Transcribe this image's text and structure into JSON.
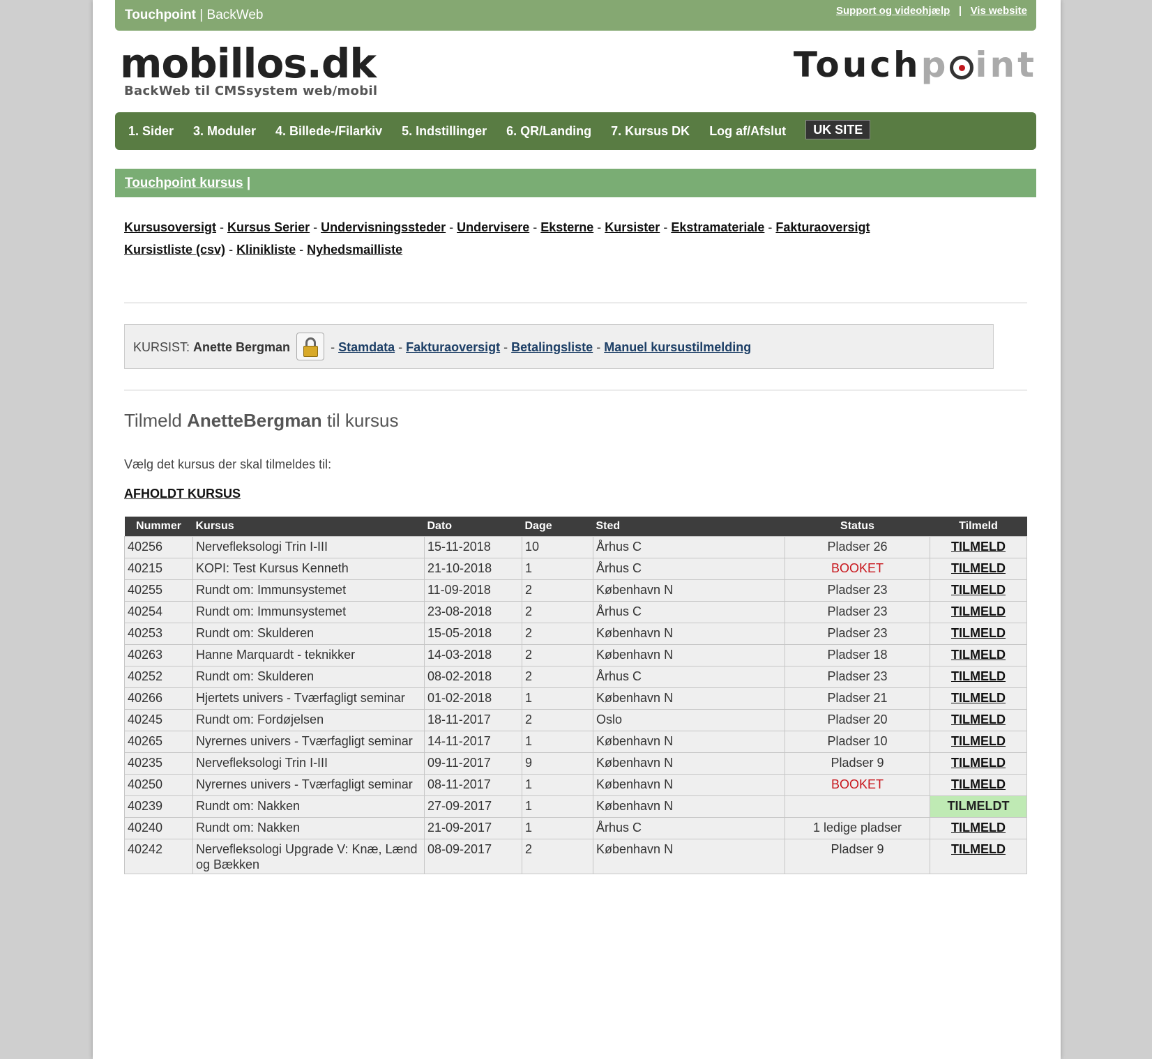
{
  "topbar": {
    "brand_bold": "Touchpoint",
    "brand_sep": " | ",
    "brand_rest": "BackWeb",
    "support_link": "Support og videohjælp",
    "sep": " | ",
    "website_link": "Vis website"
  },
  "logo_left": {
    "title": "mobillos.dk",
    "subtitle": "BackWeb til CMSsystem web/mobil"
  },
  "logo_right": {
    "part1": "Touch",
    "part2": "p",
    "part3": "int"
  },
  "mainnav": [
    "1. Sider",
    "3. Moduler",
    "4. Billede-/Filarkiv",
    "5. Indstillinger",
    "6. QR/Landing",
    "7. Kursus DK",
    "Log af/Afslut",
    "UK SITE"
  ],
  "subbar": {
    "link": "Touchpoint kursus",
    "sep": " |"
  },
  "submenu": {
    "row1": [
      "Kursusoversigt",
      "Kursus Serier",
      "Undervisningssteder",
      "Undervisere",
      "Eksterne",
      "Kursister",
      "Ekstramateriale",
      "Fakturaoversigt"
    ],
    "row2": [
      "Kursistliste (csv)",
      "Klinikliste",
      "Nyhedsmailliste"
    ],
    "sep": " - "
  },
  "kursist": {
    "label": "KURSIST: ",
    "name": "Anette Bergman",
    "dash": " - ",
    "links": [
      "Stamdata",
      "Fakturaoversigt",
      "Betalingsliste",
      "Manuel kursustilmelding"
    ]
  },
  "heading": {
    "pre": "Tilmeld ",
    "name": "AnetteBergman",
    "post": " til kursus"
  },
  "intro": "Vælg det kursus der skal tilmeldes til:",
  "afholdt": "AFHOLDT KURSUS",
  "table": {
    "headers": [
      "Nummer",
      "Kursus",
      "Dato",
      "Dage",
      "Sted",
      "Status",
      "Tilmeld"
    ],
    "rows": [
      [
        "40256",
        "Nervefleksologi Trin I-III",
        "15-11-2018",
        "10",
        "Århus C",
        "Pladser 26",
        "TILMELD"
      ],
      [
        "40215",
        "KOPI: Test Kursus Kenneth",
        "21-10-2018",
        "1",
        "Århus C",
        "BOOKET",
        "TILMELD"
      ],
      [
        "40255",
        "Rundt om: Immunsystemet",
        "11-09-2018",
        "2",
        "København N",
        "Pladser 23",
        "TILMELD"
      ],
      [
        "40254",
        "Rundt om: Immunsystemet",
        "23-08-2018",
        "2",
        "Århus C",
        "Pladser 23",
        "TILMELD"
      ],
      [
        "40253",
        "Rundt om: Skulderen",
        "15-05-2018",
        "2",
        "København N",
        "Pladser 23",
        "TILMELD"
      ],
      [
        "40263",
        "Hanne Marquardt - teknikker",
        "14-03-2018",
        "2",
        "København N",
        "Pladser 18",
        "TILMELD"
      ],
      [
        "40252",
        "Rundt om: Skulderen",
        "08-02-2018",
        "2",
        "Århus C",
        "Pladser 23",
        "TILMELD"
      ],
      [
        "40266",
        "Hjertets univers - Tværfagligt seminar",
        "01-02-2018",
        "1",
        "København N",
        "Pladser 21",
        "TILMELD"
      ],
      [
        "40245",
        "Rundt om: Fordøjelsen",
        "18-11-2017",
        "2",
        "Oslo",
        "Pladser 20",
        "TILMELD"
      ],
      [
        "40265",
        "Nyrernes univers - Tværfagligt seminar",
        "14-11-2017",
        "1",
        "København N",
        "Pladser 10",
        "TILMELD"
      ],
      [
        "40235",
        "Nervefleksologi Trin I-III",
        "09-11-2017",
        "9",
        "København N",
        "Pladser 9",
        "TILMELD"
      ],
      [
        "40250",
        "Nyrernes univers - Tværfagligt seminar",
        "08-11-2017",
        "1",
        "København N",
        "BOOKET",
        "TILMELD"
      ],
      [
        "40239",
        "Rundt om: Nakken",
        "27-09-2017",
        "1",
        "København N",
        "",
        "TILMELDT"
      ],
      [
        "40240",
        "Rundt om: Nakken",
        "21-09-2017",
        "1",
        "Århus C",
        "1 ledige pladser",
        "TILMELD"
      ],
      [
        "40242",
        "Nervefleksologi Upgrade V: Knæ, Lænd og Bækken",
        "08-09-2017",
        "2",
        "København N",
        "Pladser 9",
        "TILMELD"
      ]
    ]
  },
  "colors": {
    "topbar": "#85a872",
    "nav": "#597c43",
    "subbar": "#7aad74",
    "booked": "#c8161c",
    "enrolled": "#bfeab4"
  }
}
